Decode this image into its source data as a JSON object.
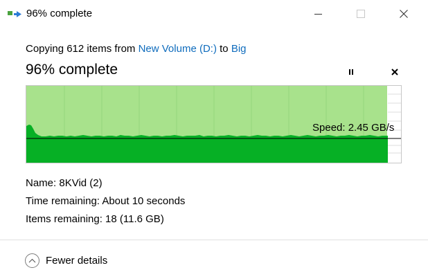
{
  "window": {
    "title": "96% complete",
    "controls": {
      "minimize": "minimize",
      "maximize": "maximize",
      "close": "close"
    }
  },
  "copy": {
    "prefix": "Copying 612 items from ",
    "source": "New Volume (D:)",
    "middle": " to ",
    "destination": "Big"
  },
  "progress": {
    "heading": "96% complete",
    "percent": 96,
    "pause_icon": "pause-icon",
    "cancel_icon": "close-icon"
  },
  "graph": {
    "speed_label": "Speed: 2.45 GB/s",
    "colors": {
      "completed_fill": "#a8e28c",
      "throughput_fill": "#06b025",
      "gridline": "#94d67b",
      "speed_line": "#000000"
    }
  },
  "details": {
    "name_label": "Name:",
    "name_value": "8KVid (2)",
    "time_label": "Time remaining:",
    "time_value": "About 10 seconds",
    "items_label": "Items remaining:",
    "items_value": "18 (11.6 GB)"
  },
  "footer": {
    "toggle_label": "Fewer details",
    "toggle_icon": "chevron-up-icon"
  }
}
